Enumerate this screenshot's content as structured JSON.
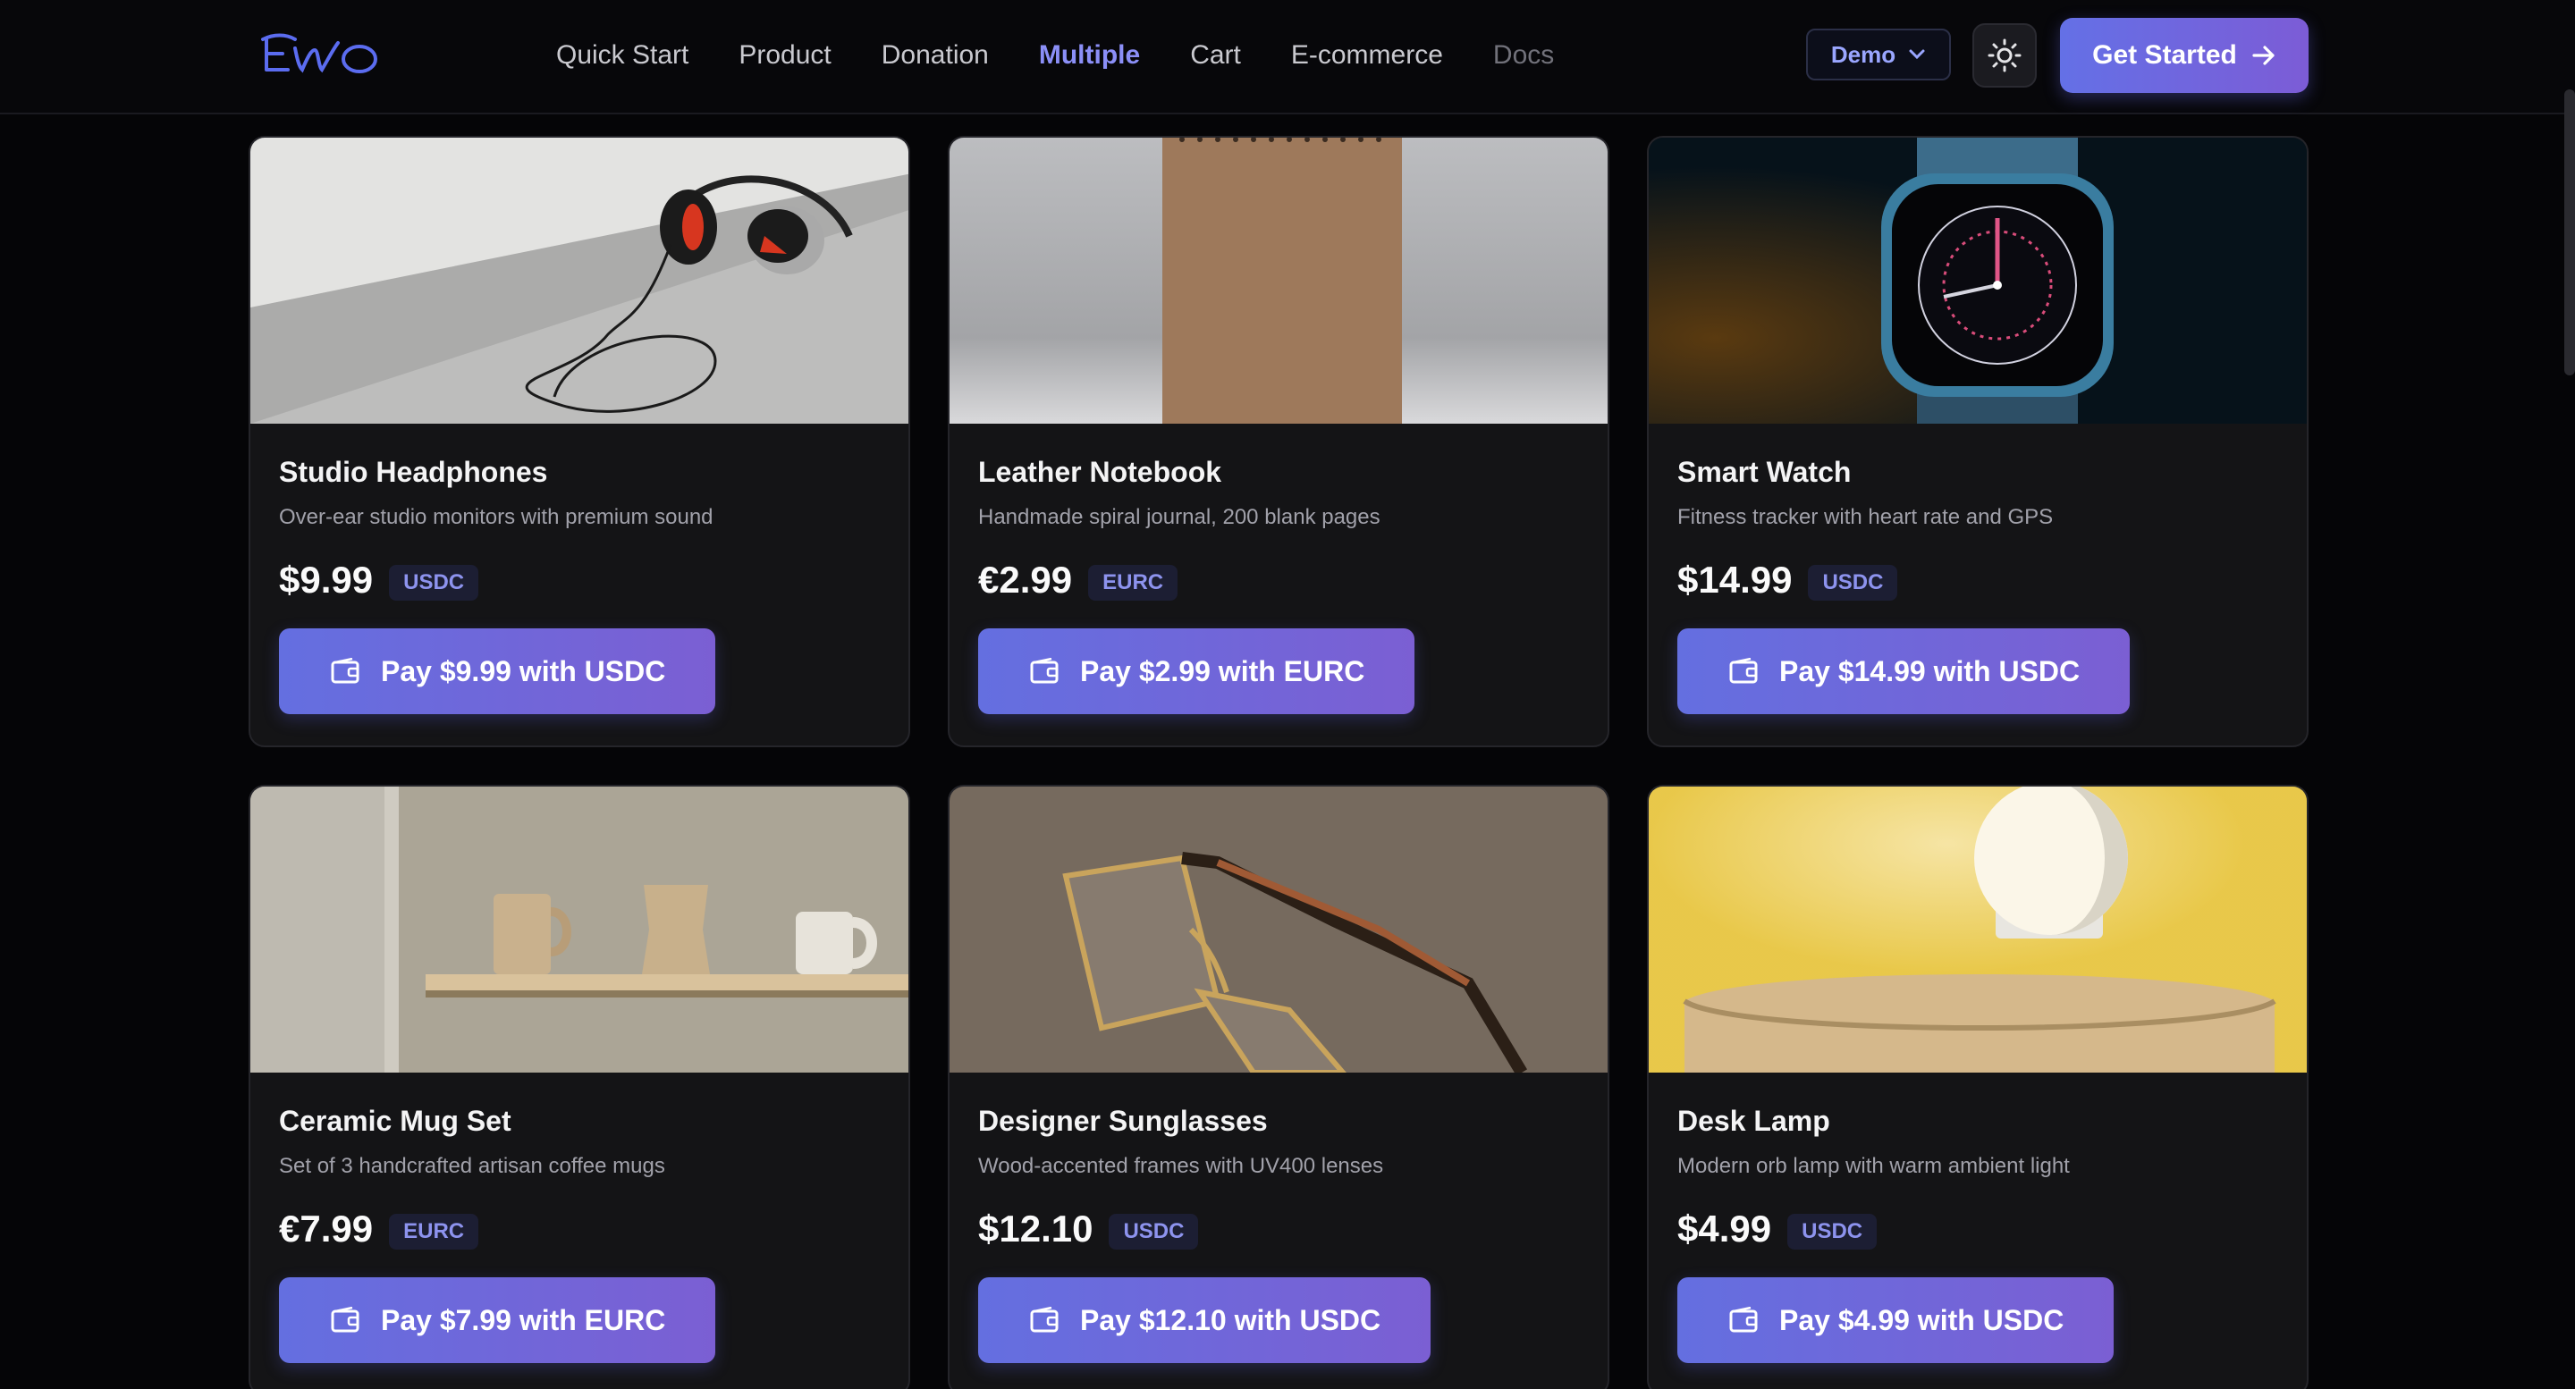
{
  "header": {
    "nav": [
      "Quick Start",
      "Product",
      "Donation",
      "Multiple",
      "Cart",
      "E-commerce",
      "Docs"
    ],
    "active": "Multiple",
    "demo_label": "Demo",
    "cta_label": "Get Started"
  },
  "colors": {
    "accent": "#6C6FE3",
    "active_link": "#8B8FF7",
    "background": "#050507",
    "card": "#141416"
  },
  "products": [
    {
      "title": "Studio Headphones",
      "desc": "Over-ear studio monitors with premium sound",
      "price": "$9.99",
      "currency": "USDC",
      "button": "Pay $9.99 with USDC"
    },
    {
      "title": "Leather Notebook",
      "desc": "Handmade spiral journal, 200 blank pages",
      "price": "€2.99",
      "currency": "EURC",
      "button": "Pay $2.99 with EURC"
    },
    {
      "title": "Smart Watch",
      "desc": "Fitness tracker with heart rate and GPS",
      "price": "$14.99",
      "currency": "USDC",
      "button": "Pay $14.99 with USDC"
    },
    {
      "title": "Ceramic Mug Set",
      "desc": "Set of 3 handcrafted artisan coffee mugs",
      "price": "€7.99",
      "currency": "EURC",
      "button": "Pay $7.99 with EURC"
    },
    {
      "title": "Designer Sunglasses",
      "desc": "Wood-accented frames with UV400 lenses",
      "price": "$12.10",
      "currency": "USDC",
      "button": "Pay $12.10 with USDC"
    },
    {
      "title": "Desk Lamp",
      "desc": "Modern orb lamp with warm ambient light",
      "price": "$4.99",
      "currency": "USDC",
      "button": "Pay $4.99 with USDC"
    }
  ],
  "icons": {
    "logo": "brand-logo",
    "theme": "sun-icon",
    "cta": "arrow-right-icon",
    "pay": "wallet-icon",
    "dropdown": "chevron-down-icon"
  }
}
